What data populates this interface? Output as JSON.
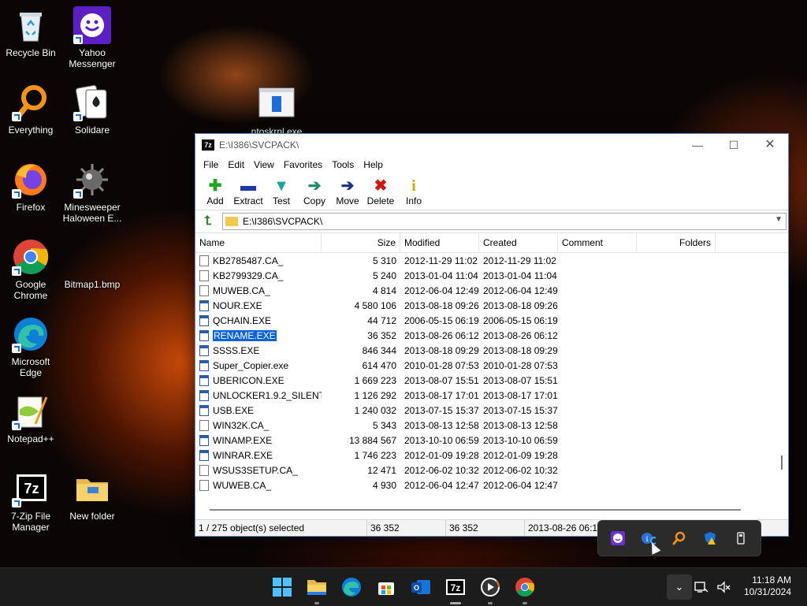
{
  "desktop": {
    "icons": [
      {
        "label": "Recycle Bin",
        "icon": "recycle-bin-icon"
      },
      {
        "label": "Yahoo Messenger",
        "icon": "yahoo-messenger-icon"
      },
      {
        "label": "Everything",
        "icon": "everything-search-icon"
      },
      {
        "label": "Solidare",
        "icon": "solitaire-icon"
      },
      {
        "label": "Firefox",
        "icon": "firefox-icon"
      },
      {
        "label": "Minesweeper Haloween E...",
        "icon": "minesweeper-icon"
      },
      {
        "label": "Google Chrome",
        "icon": "chrome-icon"
      },
      {
        "label": "Bitmap1.bmp",
        "icon": "bitmap-file-icon"
      },
      {
        "label": "Microsoft Edge",
        "icon": "edge-icon"
      },
      {
        "label": "Notepad++",
        "icon": "notepadpp-icon"
      },
      {
        "label": "7-Zip File Manager",
        "icon": "sevenzip-icon"
      },
      {
        "label": "New folder",
        "icon": "folder-icon"
      },
      {
        "label": "ntoskrnl.exe",
        "icon": "exe-file-icon"
      }
    ]
  },
  "window": {
    "logo": "7z",
    "title": "E:\\I386\\SVCPACK\\",
    "controls": {
      "minimize": "—",
      "maximize": "☐",
      "close": "✕"
    },
    "menu": [
      "File",
      "Edit",
      "View",
      "Favorites",
      "Tools",
      "Help"
    ],
    "toolbar": [
      {
        "label": "Add",
        "glyph": "✚",
        "color": "#1fa81f"
      },
      {
        "label": "Extract",
        "glyph": "▬",
        "color": "#1a3aa8"
      },
      {
        "label": "Test",
        "glyph": "▼",
        "color": "#19a39a"
      },
      {
        "label": "Copy",
        "glyph": "➔",
        "color": "#1e8c6b"
      },
      {
        "label": "Move",
        "glyph": "➔",
        "color": "#1a2f8c"
      },
      {
        "label": "Delete",
        "glyph": "✖",
        "color": "#d01515"
      },
      {
        "label": "Info",
        "glyph": "i",
        "color": "#c9a800"
      }
    ],
    "address": "E:\\I386\\SVCPACK\\",
    "columns": [
      "Name",
      "Size",
      "Modified",
      "Created",
      "Comment",
      "Folders"
    ],
    "files": [
      {
        "name": "KB2785487.CA_",
        "size": "5 310",
        "modified": "2012-11-29 11:02",
        "created": "2012-11-29 11:02",
        "type": "file"
      },
      {
        "name": "KB2799329.CA_",
        "size": "5 240",
        "modified": "2013-01-04 11:04",
        "created": "2013-01-04 11:04",
        "type": "file"
      },
      {
        "name": "MUWEB.CA_",
        "size": "4 814",
        "modified": "2012-06-04 12:49",
        "created": "2012-06-04 12:49",
        "type": "file"
      },
      {
        "name": "NOUR.EXE",
        "size": "4 580 106",
        "modified": "2013-08-18 09:26",
        "created": "2013-08-18 09:26",
        "type": "exe"
      },
      {
        "name": "QCHAIN.EXE",
        "size": "44 712",
        "modified": "2006-05-15 06:19",
        "created": "2006-05-15 06:19",
        "type": "exe"
      },
      {
        "name": "RENAME.EXE",
        "size": "36 352",
        "modified": "2013-08-26 06:12",
        "created": "2013-08-26 06:12",
        "type": "exe",
        "selected": true
      },
      {
        "name": "SSSS.EXE",
        "size": "846 344",
        "modified": "2013-08-18 09:29",
        "created": "2013-08-18 09:29",
        "type": "exe"
      },
      {
        "name": "Super_Copier.exe",
        "size": "614 470",
        "modified": "2010-01-28 07:53",
        "created": "2010-01-28 07:53",
        "type": "exe"
      },
      {
        "name": "UBERICON.EXE",
        "size": "1 669 223",
        "modified": "2013-08-07 15:51",
        "created": "2013-08-07 15:51",
        "type": "exe"
      },
      {
        "name": "UNLOCKER1.9.2_SILENT...",
        "size": "1 126 292",
        "modified": "2013-08-17 17:01",
        "created": "2013-08-17 17:01",
        "type": "exe"
      },
      {
        "name": "USB.EXE",
        "size": "1 240 032",
        "modified": "2013-07-15 15:37",
        "created": "2013-07-15 15:37",
        "type": "exe"
      },
      {
        "name": "WIN32K.CA_",
        "size": "5 343",
        "modified": "2013-08-13 12:58",
        "created": "2013-08-13 12:58",
        "type": "file"
      },
      {
        "name": "WINAMP.EXE",
        "size": "13 884 567",
        "modified": "2013-10-10 06:59",
        "created": "2013-10-10 06:59",
        "type": "exe"
      },
      {
        "name": "WINRAR.EXE",
        "size": "1 746 223",
        "modified": "2012-01-09 19:28",
        "created": "2012-01-09 19:28",
        "type": "exe"
      },
      {
        "name": "WSUS3SETUP.CA_",
        "size": "12 471",
        "modified": "2012-06-02 10:32",
        "created": "2012-06-02 10:32",
        "type": "file"
      },
      {
        "name": "WUWEB.CA_",
        "size": "4 930",
        "modified": "2012-06-04 12:47",
        "created": "2012-06-04 12:47",
        "type": "file"
      }
    ],
    "status": {
      "selection": "1 / 275 object(s) selected",
      "size1": "36 352",
      "size2": "36 352",
      "date": "2013-08-26 06:12"
    }
  },
  "tray_overflow": {
    "icons": [
      "yahoo-messenger-tray-icon",
      "everything-tray-icon",
      "search-tray-icon",
      "defender-warning-icon",
      "usb-eject-icon"
    ]
  },
  "taskbar": {
    "apps": [
      {
        "name": "start-button"
      },
      {
        "name": "file-explorer-taskbar"
      },
      {
        "name": "edge-taskbar"
      },
      {
        "name": "store-taskbar"
      },
      {
        "name": "outlook-taskbar"
      },
      {
        "name": "sevenzip-taskbar",
        "label": "7z"
      },
      {
        "name": "media-player-taskbar"
      },
      {
        "name": "chrome-taskbar"
      }
    ],
    "time": "11:18 AM",
    "date": "10/31/2024"
  }
}
